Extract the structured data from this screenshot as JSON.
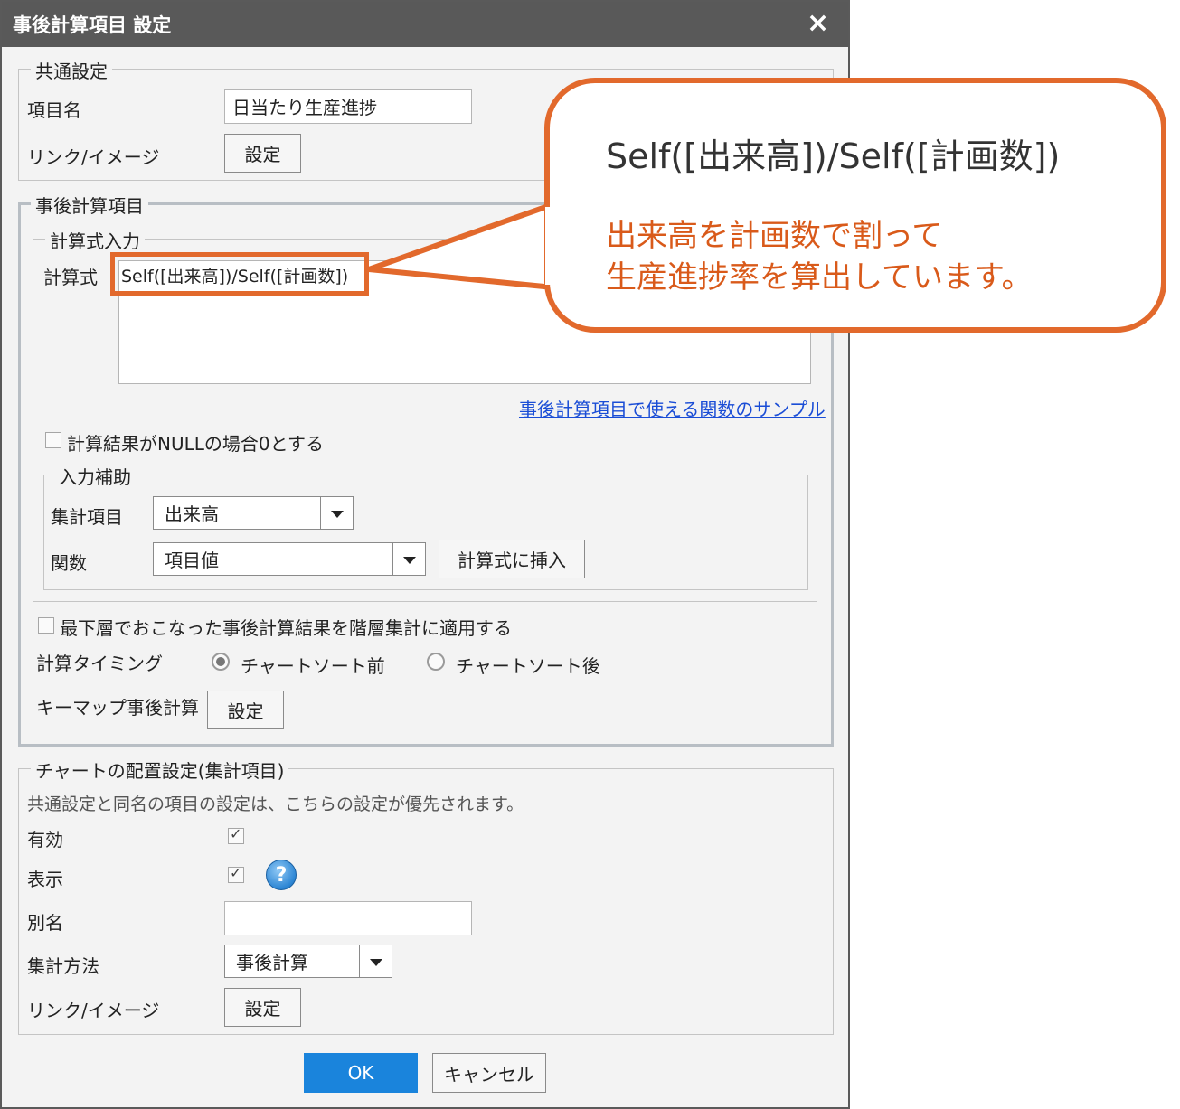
{
  "dialog": {
    "title": "事後計算項目 設定",
    "close_glyph": "×"
  },
  "common": {
    "legend": "共通設定",
    "item_name_label": "項目名",
    "item_name_value": "日当たり生産進捗",
    "link_label": "リンク/イメージ",
    "link_button": "設定"
  },
  "calc": {
    "legend": "事後計算項目",
    "formula_group": {
      "legend": "計算式入力",
      "formula_label": "計算式",
      "formula_value": "Self([出来高])/Self([計画数])",
      "sample_link": "事後計算項目で使える関数のサンプル"
    },
    "null_zero_checkbox": {
      "label": "計算結果がNULLの場合0とする",
      "checked": false
    },
    "assist": {
      "legend": "入力補助",
      "agg_item_label": "集計項目",
      "agg_item_value": "出来高",
      "func_label": "関数",
      "func_value": "項目値",
      "insert_button": "計算式に挿入"
    },
    "apply_checkbox": {
      "label": "最下層でおこなった事後計算結果を階層集計に適用する",
      "checked": false
    },
    "timing": {
      "label": "計算タイミング",
      "options": [
        {
          "label": "チャートソート前",
          "checked": true
        },
        {
          "label": "チャートソート後",
          "checked": false
        }
      ]
    },
    "keymap_label": "キーマップ事後計算",
    "keymap_button": "設定"
  },
  "chart": {
    "legend": "チャートの配置設定(集計項目)",
    "note": "共通設定と同名の項目の設定は、こちらの設定が優先されます。",
    "enabled_label": "有効",
    "enabled_checked": true,
    "display_label": "表示",
    "display_checked": true,
    "help_glyph": "?",
    "alias_label": "別名",
    "alias_value": "",
    "method_label": "集計方法",
    "method_value": "事後計算",
    "link_label": "リンク/イメージ",
    "link_button": "設定"
  },
  "footer": {
    "ok": "OK",
    "cancel": "キャンセル"
  },
  "callout": {
    "formula": "Self([出来高])/Self([計画数])",
    "note_line1": "出来高を計画数で割って",
    "note_line2": "生産進捗率を算出しています。"
  },
  "colors": {
    "accent": "#e2692c",
    "note_text": "#d95a1a",
    "ok_button": "#1a84dc",
    "titlebar": "#595959"
  }
}
